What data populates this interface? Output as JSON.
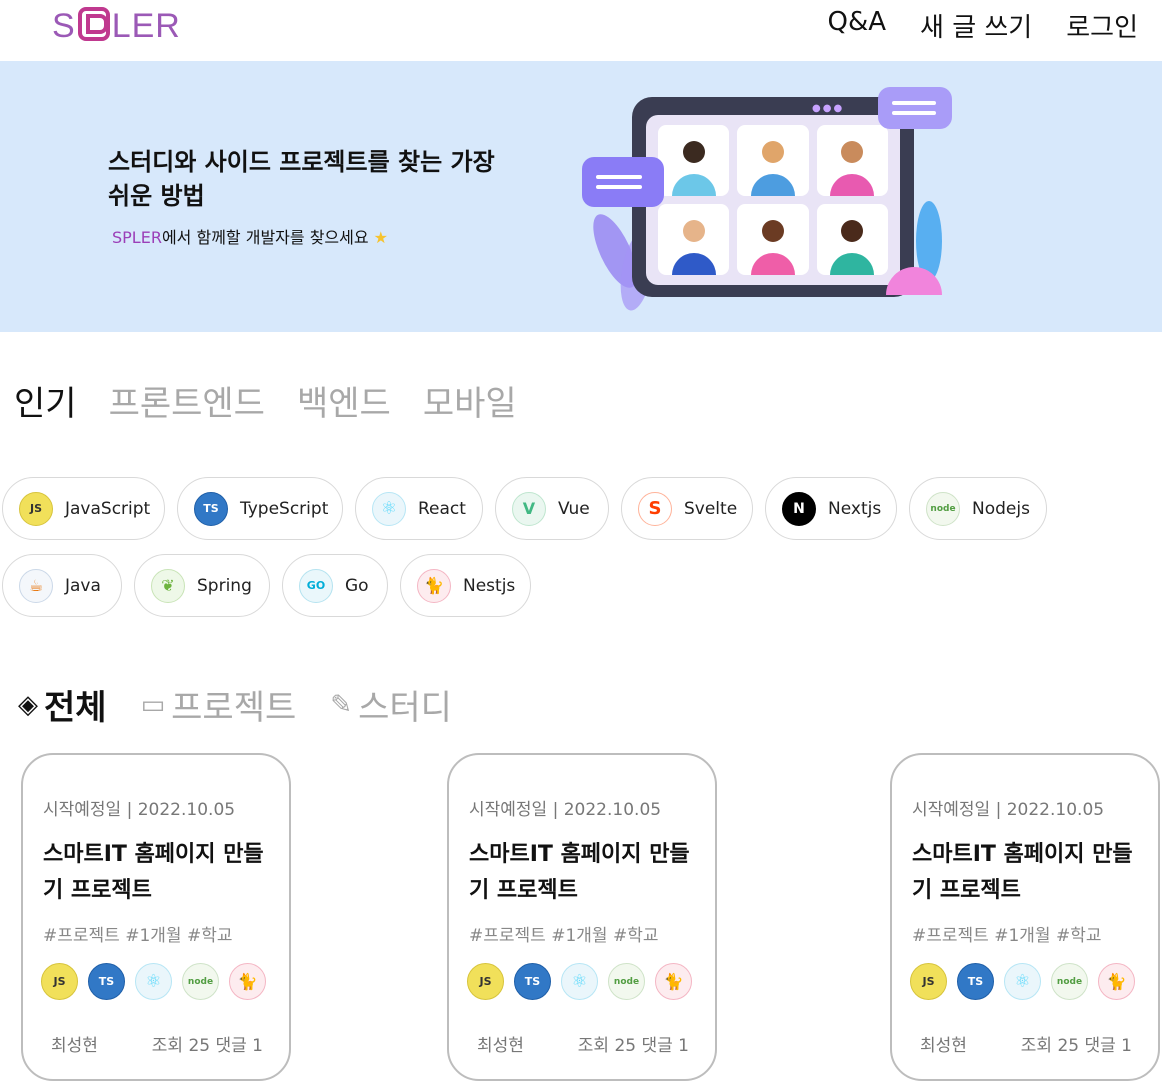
{
  "header": {
    "logo": "SPLER",
    "nav": [
      {
        "label": "Q&A"
      },
      {
        "label": "새 글 쓰기"
      },
      {
        "label": "로그인"
      }
    ]
  },
  "banner": {
    "title": "스터디와 사이드 프로젝트를 찾는 가장 쉬운 방법",
    "subtitle_logo": "SPLER",
    "subtitle_text": "에서 함께할 개발자를 찾으세요",
    "subtitle_icon": "star-icon"
  },
  "category_tabs": [
    {
      "label": "인기",
      "active": true
    },
    {
      "label": "프론트엔드",
      "active": false
    },
    {
      "label": "백엔드",
      "active": false
    },
    {
      "label": "모바일",
      "active": false
    }
  ],
  "stacks_row1": [
    {
      "label": "JavaScript",
      "icon": "javascript-icon",
      "glyph": "JS"
    },
    {
      "label": "TypeScript",
      "icon": "typescript-icon",
      "glyph": "TS"
    },
    {
      "label": "React",
      "icon": "react-icon",
      "glyph": "⚛"
    },
    {
      "label": "Vue",
      "icon": "vue-icon",
      "glyph": "V"
    },
    {
      "label": "Svelte",
      "icon": "svelte-icon",
      "glyph": "S"
    },
    {
      "label": "Nextjs",
      "icon": "nextjs-icon",
      "glyph": "N"
    },
    {
      "label": "Nodejs",
      "icon": "nodejs-icon",
      "glyph": "node"
    }
  ],
  "stacks_row2": [
    {
      "label": "Java",
      "icon": "java-icon",
      "glyph": "☕"
    },
    {
      "label": "Spring",
      "icon": "spring-icon",
      "glyph": "❦"
    },
    {
      "label": "Go",
      "icon": "go-icon",
      "glyph": "GO"
    },
    {
      "label": "Nestjs",
      "icon": "nestjs-icon",
      "glyph": "🐈"
    }
  ],
  "type_tabs": [
    {
      "label": "전체",
      "icon": "layers-icon",
      "active": true
    },
    {
      "label": "프로젝트",
      "icon": "folder-icon",
      "active": false
    },
    {
      "label": "스터디",
      "icon": "pencil-icon",
      "active": false
    }
  ],
  "cards": [
    {
      "date": "시작예정일 | 2022.10.05",
      "title": "스마트IT 홈페이지 만들기 프로젝트",
      "tags": "#프로젝트 #1개월 #학교",
      "stacks": [
        "javascript-icon",
        "typescript-icon",
        "react-icon",
        "nodejs-icon",
        "nestjs-icon"
      ],
      "author": "최성현",
      "stats": "조회 25 댓글 1"
    },
    {
      "date": "시작예정일 | 2022.10.05",
      "title": "스마트IT 홈페이지 만들기 프로젝트",
      "tags": "#프로젝트 #1개월 #학교",
      "stacks": [
        "javascript-icon",
        "typescript-icon",
        "react-icon",
        "nodejs-icon",
        "nestjs-icon"
      ],
      "author": "최성현",
      "stats": "조회 25 댓글 1"
    },
    {
      "date": "시작예정일 | 2022.10.05",
      "title": "스마트IT 홈페이지 만들기 프로젝트",
      "tags": "#프로젝트 #1개월 #학교",
      "stacks": [
        "javascript-icon",
        "typescript-icon",
        "react-icon",
        "nodejs-icon",
        "nestjs-icon"
      ],
      "author": "최성현",
      "stats": "조회 25 댓글 1"
    }
  ]
}
